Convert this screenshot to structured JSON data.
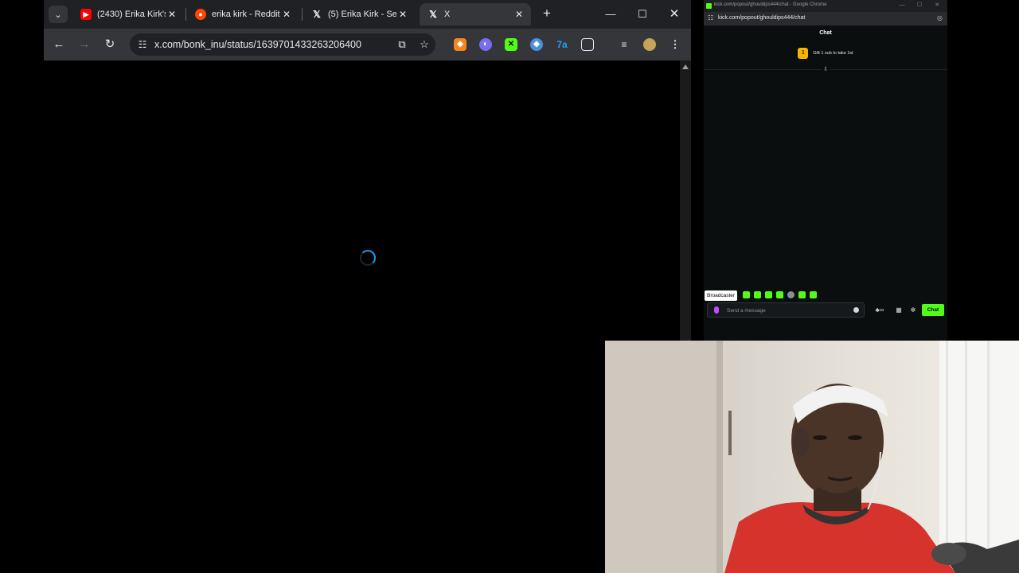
{
  "browser": {
    "tabs": [
      {
        "title": "(2430) Erika Kirk's",
        "favicon": "youtube-icon",
        "color": "#ff0000"
      },
      {
        "title": "erika kirk - Reddit",
        "favicon": "reddit-icon",
        "color": "#ff4500"
      },
      {
        "title": "(5) Erika Kirk - Se",
        "favicon": "x-icon",
        "color": "#000000"
      },
      {
        "title": "X",
        "favicon": "x-icon",
        "color": "#000000",
        "active": true
      }
    ],
    "url": "x.com/bonk_inu/status/1639701433263206400"
  },
  "kick": {
    "window_title": "kick.com/popout/ghouldips444/chat - Google Chrome",
    "url": "kick.com/popout/ghouldips444/chat",
    "chat_header": "Chat",
    "gift_badge": "1",
    "gift_text": "Gift 1 sub to take 1st",
    "broadcaster_label": "Broadcaster",
    "message_placeholder": "Send a message",
    "chat_button": "Chat",
    "accent": "#53fc18"
  },
  "webcam": {
    "description_icon": "webcam-feed"
  }
}
